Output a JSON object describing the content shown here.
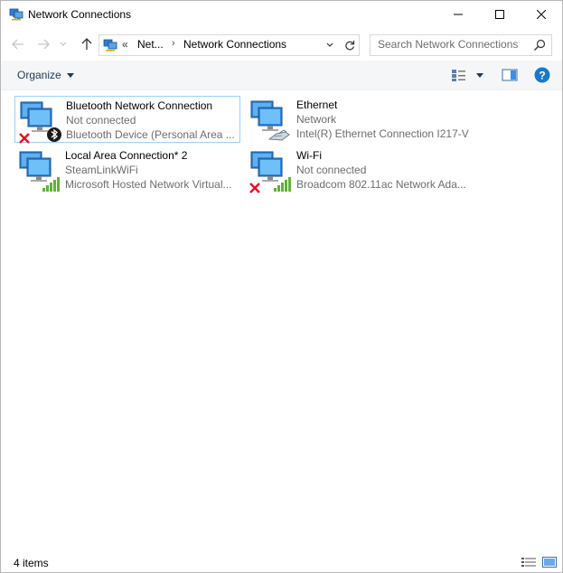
{
  "window": {
    "title": "Network Connections"
  },
  "nav": {
    "address_overflow": "«",
    "breadcrumb": [
      "Net...",
      "Network Connections"
    ],
    "breadcrumb_sep": "›",
    "search_placeholder": "Search Network Connections"
  },
  "toolbar": {
    "organize_label": "Organize"
  },
  "items": [
    {
      "name": "Bluetooth Network Connection",
      "status": "Not connected",
      "device": "Bluetooth Device (Personal Area ...",
      "icon": "bluetooth-adapter-icon",
      "badge": "disconnected-x-icon",
      "selected": true
    },
    {
      "name": "Ethernet",
      "status": "Network",
      "device": "Intel(R) Ethernet Connection I217-V",
      "icon": "ethernet-adapter-icon",
      "badge": "",
      "selected": false
    },
    {
      "name": "Local Area Connection* 2",
      "status": "SteamLinkWiFi",
      "device": "Microsoft Hosted Network Virtual...",
      "icon": "wireless-adapter-icon",
      "badge": "",
      "selected": false
    },
    {
      "name": "Wi-Fi",
      "status": "Not connected",
      "device": "Broadcom 802.11ac Network Ada...",
      "icon": "wireless-adapter-icon",
      "badge": "disconnected-x-icon",
      "selected": false
    }
  ],
  "status": {
    "count": "4 items"
  },
  "colors": {
    "accent": "#0078d7",
    "selected_border": "#99d1ff",
    "disconnected": "#e81123",
    "signal": "#5fb336"
  }
}
